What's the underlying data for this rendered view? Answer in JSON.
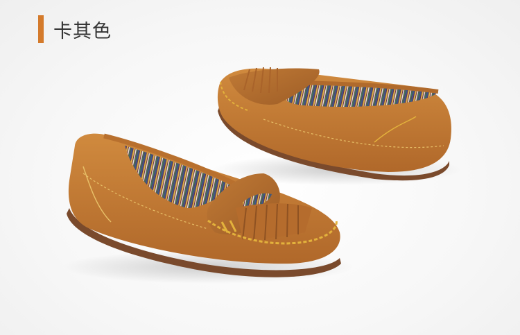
{
  "heading": {
    "title": "卡其色",
    "accent_color": "#d47a2b"
  },
  "product": {
    "image_description_icon": "suede-tassel-loafers-pair-image",
    "suede_color": "#c2762f",
    "sole_color": "#7a4a2c",
    "stitch_color": "#e3b23c"
  }
}
